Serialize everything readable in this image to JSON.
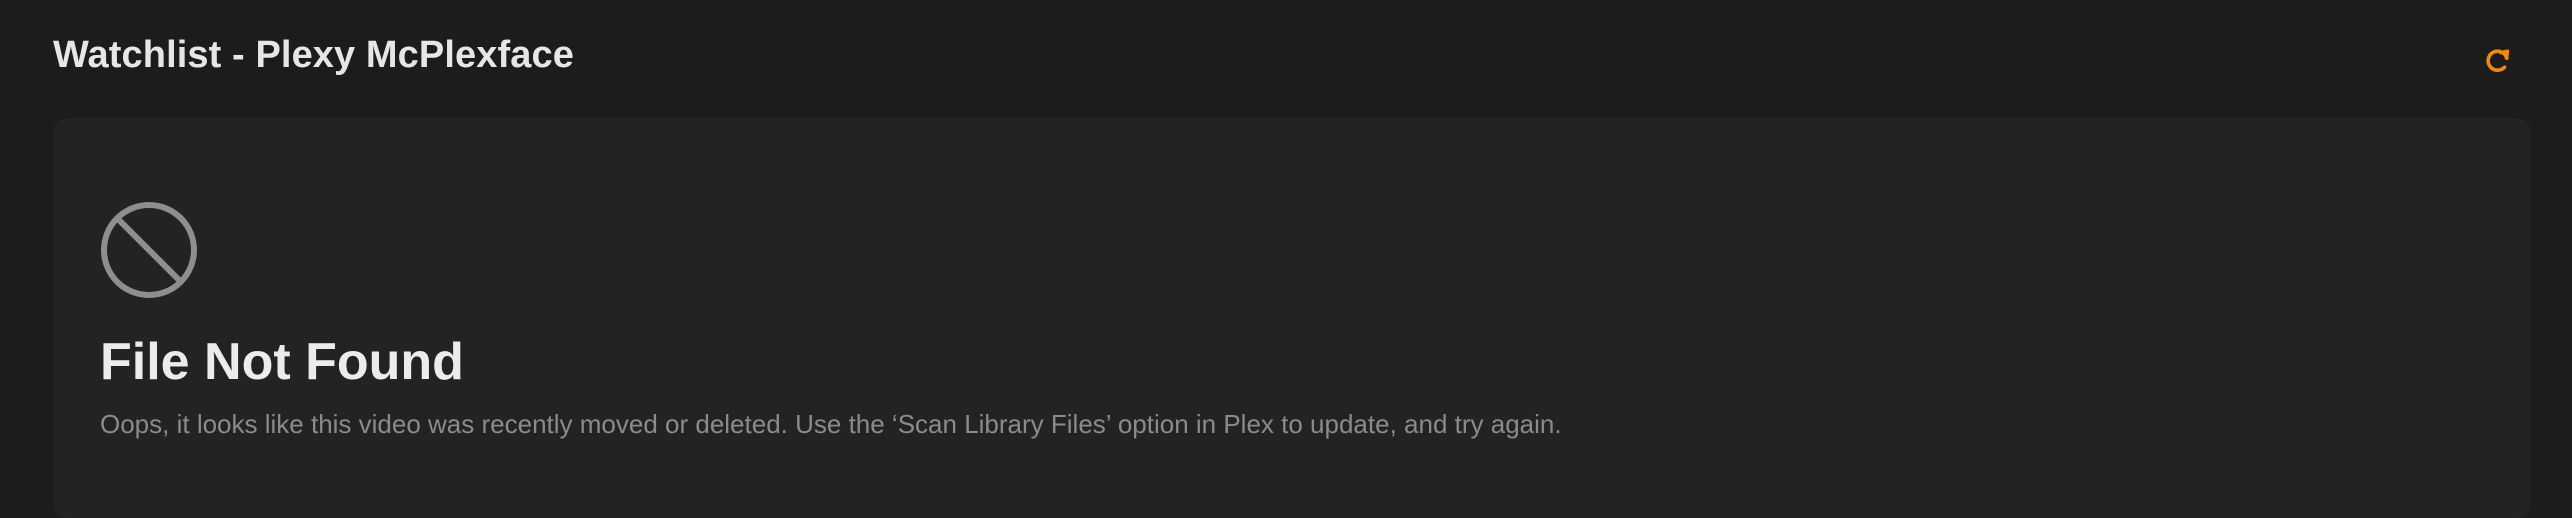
{
  "header": {
    "title": "Watchlist - Plexy McPlexface",
    "refresh_icon": "refresh-icon"
  },
  "empty_state": {
    "icon": "no-entry-icon",
    "title": "File Not Found",
    "message": "Oops, it looks like this video was recently moved or deleted. Use the ‘Scan Library Files’ option in Plex to update, and try again."
  },
  "colors": {
    "background": "#1c1c1c",
    "card": "#232323",
    "accent": "#e5a00d",
    "title_text": "#e6e6e6",
    "muted_text": "#8b8b8b",
    "icon_gray": "#8e8e8e"
  }
}
